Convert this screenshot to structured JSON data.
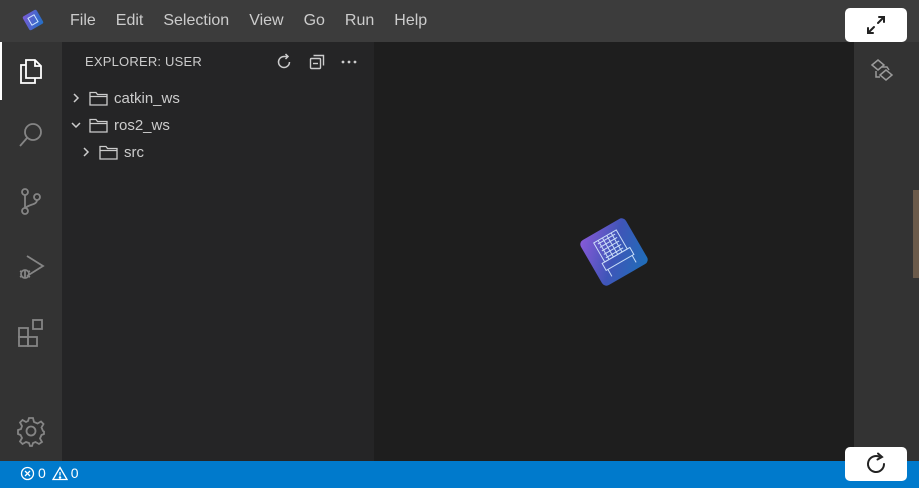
{
  "menu": {
    "items": [
      "File",
      "Edit",
      "Selection",
      "View",
      "Go",
      "Run",
      "Help"
    ]
  },
  "activity_bar": {
    "items": [
      {
        "icon": "files-icon",
        "active": true
      },
      {
        "icon": "search-icon",
        "active": false
      },
      {
        "icon": "source-control-icon",
        "active": false
      },
      {
        "icon": "run-debug-icon",
        "active": false
      },
      {
        "icon": "extensions-icon",
        "active": false
      }
    ],
    "bottom": {
      "icon": "gear-icon"
    }
  },
  "sidebar": {
    "title": "EXPLORER: USER",
    "actions": [
      "refresh-icon",
      "collapse-all-icon",
      "more-icon"
    ],
    "tree": [
      {
        "label": "catkin_ws",
        "expanded": false,
        "depth": 0
      },
      {
        "label": "ros2_ws",
        "expanded": true,
        "depth": 0
      },
      {
        "label": "src",
        "expanded": false,
        "depth": 1
      }
    ]
  },
  "status_bar": {
    "errors": "0",
    "warnings": "0"
  },
  "colors": {
    "status_bar": "#007acc",
    "activity_bar": "#333333",
    "sidebar": "#252526",
    "editor": "#1e1e1e",
    "titlebar": "#3c3c3c"
  }
}
